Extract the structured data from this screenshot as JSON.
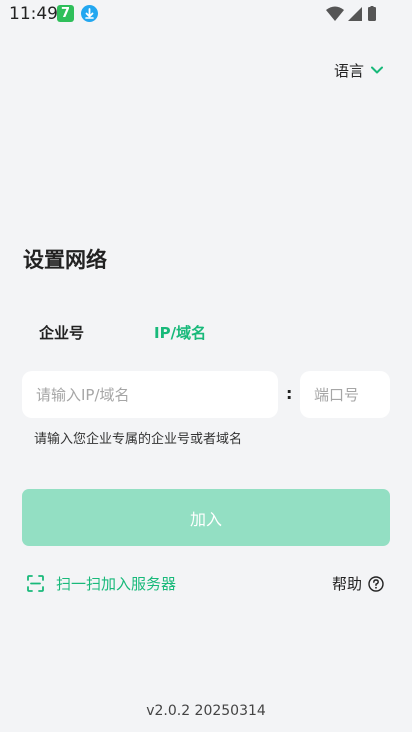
{
  "status_bar": {
    "time": "11:49",
    "app_badge_text": "7"
  },
  "header": {
    "language_label": "语言"
  },
  "page_title": "设置网络",
  "tabs": [
    {
      "label": "企业号",
      "active": false
    },
    {
      "label": "IP/域名",
      "active": true
    }
  ],
  "form": {
    "ip_placeholder": "请输入IP/域名",
    "separator": ":",
    "port_placeholder": "端口号",
    "hint": "请输入您企业专属的企业号或者域名",
    "join_label": "加入"
  },
  "actions": {
    "scan_label": "扫一扫加入服务器",
    "help_label": "帮助"
  },
  "version": "v2.0.2 20250314",
  "colors": {
    "accent": "#18b97a",
    "button_disabled": "#93dfc3",
    "background": "#f3f4f6"
  }
}
